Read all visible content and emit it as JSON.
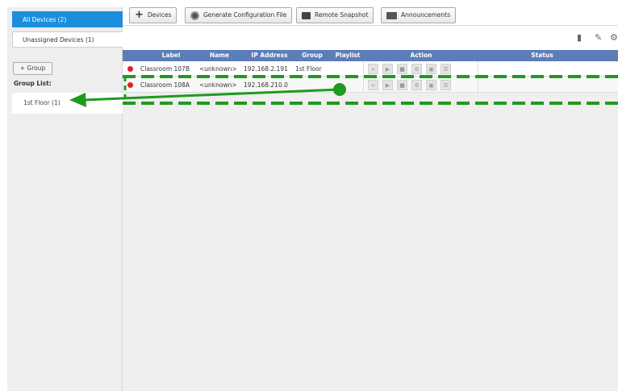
{
  "sidebar": {
    "all_devices": "All Devices (2)",
    "unassigned_devices": "Unassigned Devices (1)",
    "add_group": "+ Group",
    "group_list_label": "Group List:",
    "groups": [
      "1st Floor (1)"
    ]
  },
  "toolbar": {
    "devices": "Devices",
    "generate_config": "Generate Configuration File",
    "remote_snapshot": "Remote Snapshot",
    "announcements": "Announcements"
  },
  "table": {
    "columns": {
      "label": "Label",
      "name": "Name",
      "ip": "IP Address",
      "group": "Group",
      "playlist": "Playlist",
      "action": "Action",
      "status": "Status"
    },
    "rows": [
      {
        "label": "Classroom 107B",
        "name": "<unknown>",
        "ip": "192.168.2.191",
        "group": "1st Floor",
        "playlist": "",
        "status_color": "#e02020"
      },
      {
        "label": "Classroom 108A",
        "name": "<unknown>",
        "ip": "192.168.210.0",
        "group": "",
        "playlist": "",
        "status_color": "#e02020"
      }
    ]
  },
  "annotation": {
    "dash_color": "#1f9a1f",
    "arrow_color": "#1f9a1f"
  }
}
